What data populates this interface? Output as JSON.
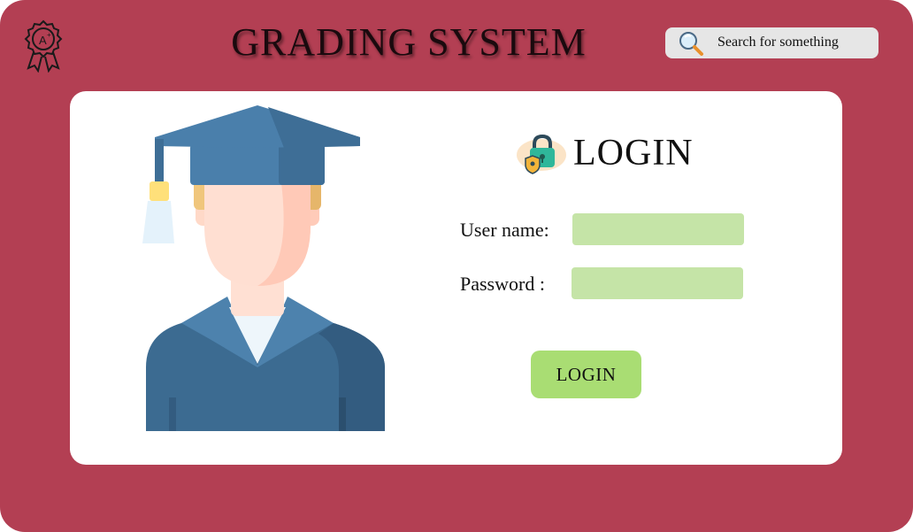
{
  "header": {
    "title": "GRADING SYSTEM",
    "badge_icon": "award-badge-icon",
    "search": {
      "placeholder": "Search for something",
      "icon": "search-icon"
    }
  },
  "login_card": {
    "illustration": "graduate-student-illustration",
    "heading": "LOGIN",
    "heading_icon": "lock-shield-icon",
    "username_label": "User name:",
    "username_value": "",
    "password_label": "Password  :",
    "password_value": "",
    "submit_label": "LOGIN"
  },
  "colors": {
    "background": "#b33f53",
    "card": "#ffffff",
    "input_fill": "#c5e4a7",
    "button_fill": "#a9dd73",
    "search_fill": "#e6e6e6"
  }
}
